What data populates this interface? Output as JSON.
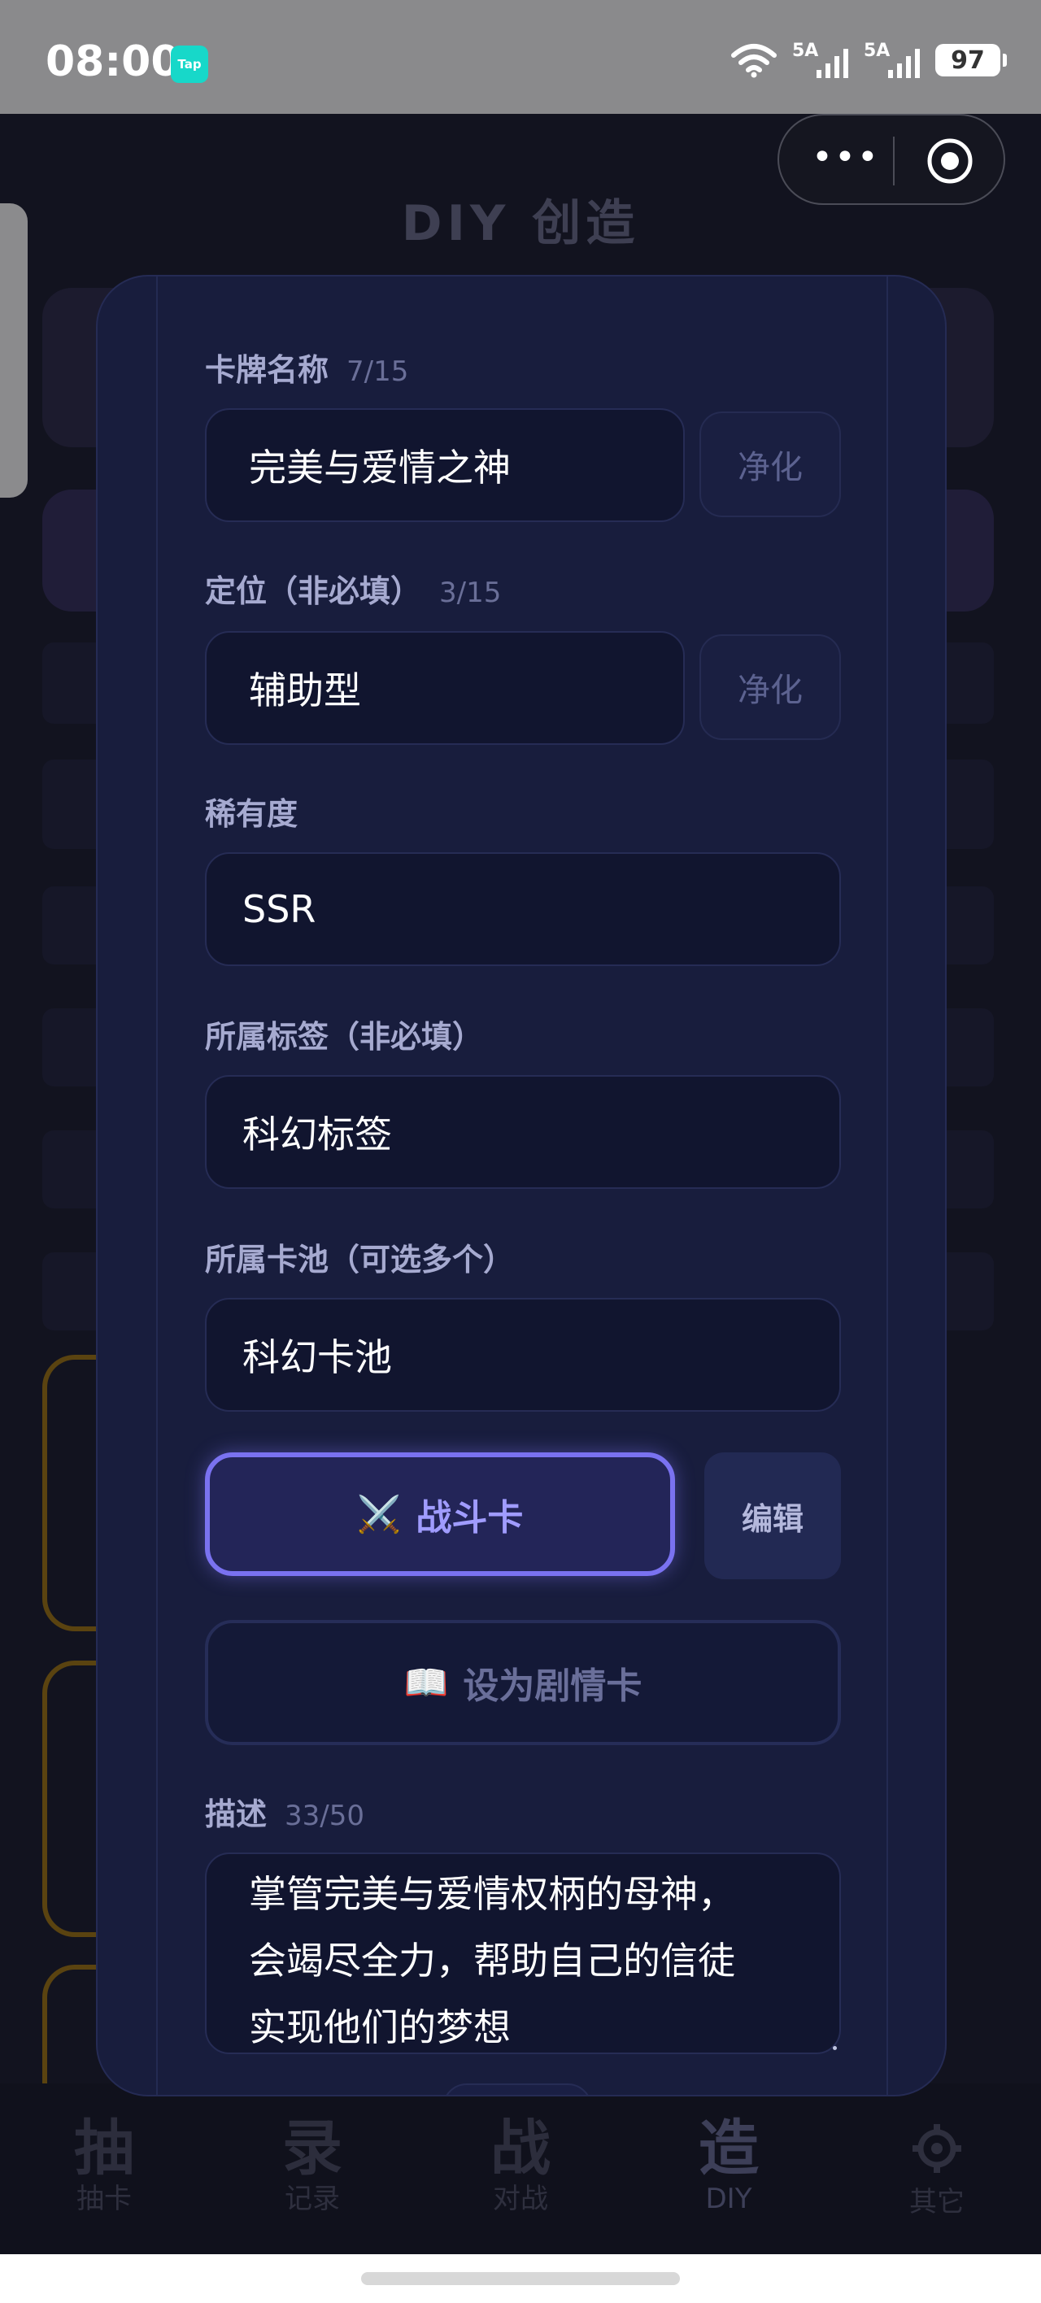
{
  "status_bar": {
    "time": "08:00",
    "app_badge": "Tap",
    "net1": "5A",
    "net2": "5A",
    "battery": "97"
  },
  "background": {
    "page_title": "DIY 创造"
  },
  "modal": {
    "card_name": {
      "label": "卡牌名称",
      "count": "7/15",
      "value": "完美与爱情之神",
      "clean_label": "净化"
    },
    "position": {
      "label": "定位（非必填）",
      "count": "3/15",
      "value": "辅助型",
      "clean_label": "净化"
    },
    "rarity": {
      "label": "稀有度",
      "value": "SSR"
    },
    "tag": {
      "label": "所属标签（非必填）",
      "value": "科幻标签"
    },
    "pool": {
      "label": "所属卡池（可选多个）",
      "value": "科幻卡池"
    },
    "battle_button": {
      "icon": "⚔️",
      "label": "战斗卡"
    },
    "edit_button": "编辑",
    "story_button": {
      "icon": "📖",
      "label": "设为剧情卡"
    },
    "description": {
      "label": "描述",
      "count": "33/50",
      "lines": [
        "掌管完美与爱情权柄的母神，",
        "会竭尽全力，帮助自己的信徒",
        "实现他们的梦想"
      ]
    }
  },
  "bottom_nav": {
    "items": [
      {
        "big": "抽",
        "small": "抽卡"
      },
      {
        "big": "录",
        "small": "记录"
      },
      {
        "big": "战",
        "small": "对战"
      },
      {
        "big": "造",
        "small": "DIY"
      },
      {
        "small": "其它"
      }
    ]
  },
  "colors": {
    "accent": "#7a72f0",
    "modal_bg": "#181d3d",
    "input_bg": "#11152f",
    "teal_badge": "#17d8c9"
  }
}
